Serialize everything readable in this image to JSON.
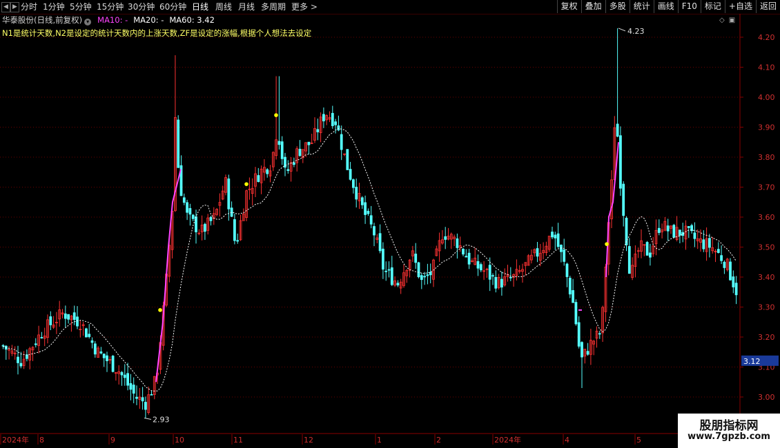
{
  "toolbar": {
    "periods": [
      "分时",
      "1分钟",
      "5分钟",
      "15分钟",
      "30分钟",
      "60分钟",
      "日线",
      "周线",
      "月线",
      "多周期",
      "更多 >"
    ],
    "active_period": "日线",
    "right_buttons": [
      "复权",
      "叠加",
      "多股",
      "统计",
      "画线",
      "F10",
      "标记",
      "+自选",
      "返回"
    ]
  },
  "info": {
    "stock_name": "华泰股份(日线,前复权)",
    "ma10": "MA10: -",
    "ma20": "MA20: -",
    "ma60": "MA60: 3.42",
    "description": "N1是统计天数,N2是设定的统计天数内的上涨天数,ZF是设定的涨幅,根据个人想法去设定"
  },
  "chart_data": {
    "type": "candlestick",
    "y_ticks": [
      "4.20",
      "4.10",
      "4.00",
      "3.90",
      "3.80",
      "3.70",
      "3.60",
      "3.50",
      "3.40",
      "3.30",
      "3.20",
      "3.10",
      "3.00"
    ],
    "ylim": [
      2.88,
      4.28
    ],
    "x_labels": [
      "2024年",
      "8",
      "9",
      "10",
      "11",
      "12",
      "1",
      "2",
      "2024年",
      "4",
      "5"
    ],
    "last_price": "3.12",
    "high_label": "4.23",
    "low_label": "2.93",
    "up_color": "#ff3232",
    "down_color": "#54ffff",
    "ma_color": "#ffffff",
    "signal_color": "#ff44ff",
    "dot_color": "#ffff00"
  },
  "watermark": {
    "title": "股朋指标网",
    "url": "www.7gpzb.com"
  }
}
